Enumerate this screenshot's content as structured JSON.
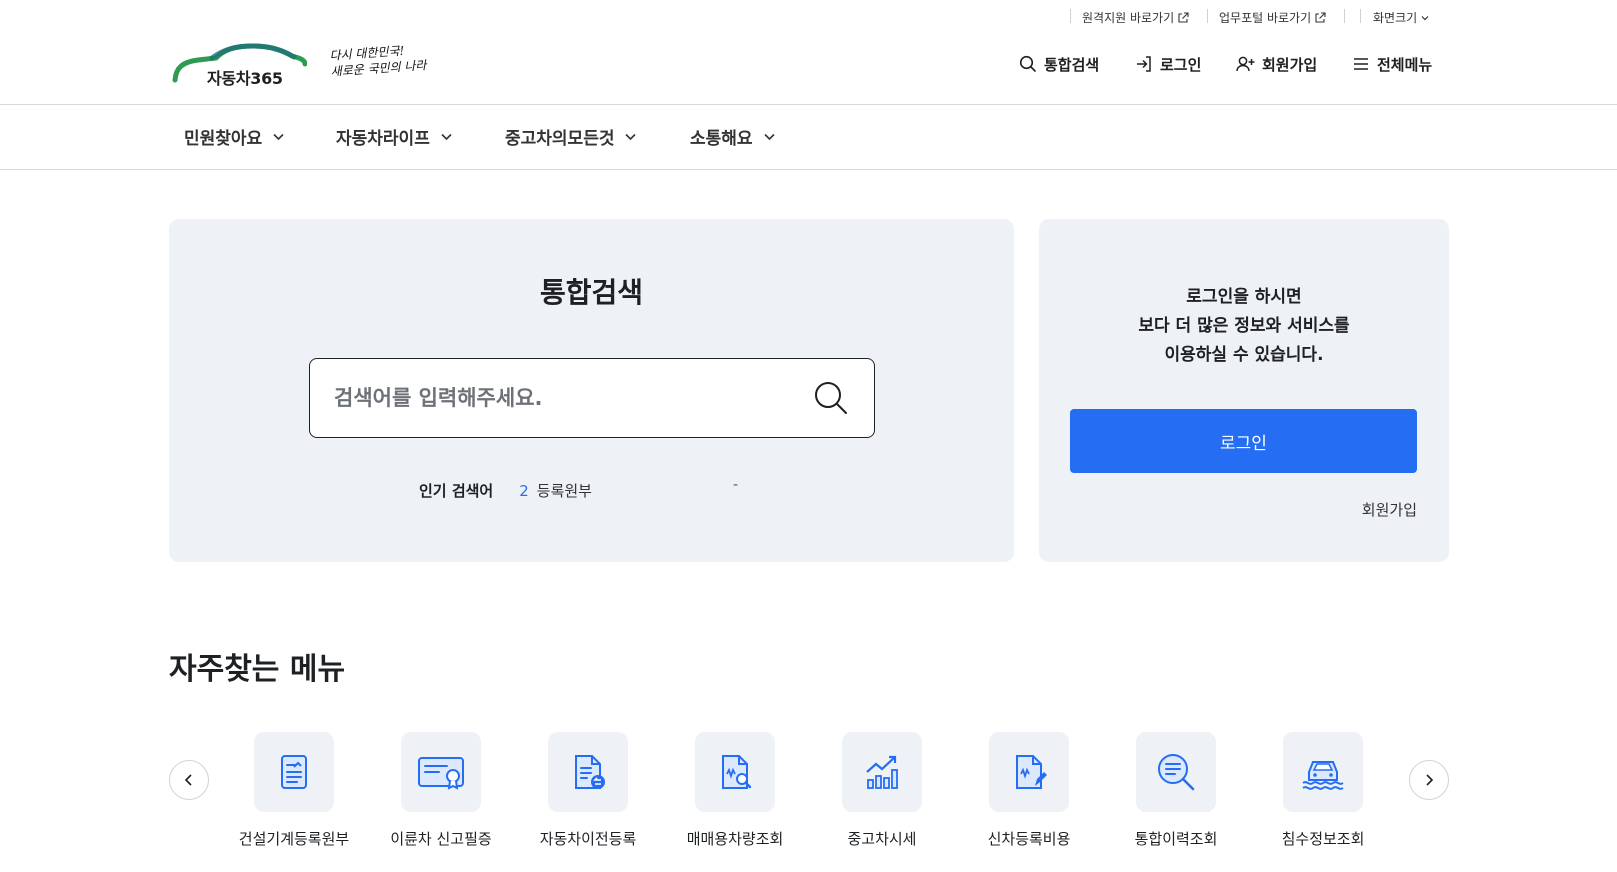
{
  "colors": {
    "accent": "#256ef4",
    "card_bg": "#eef1f5",
    "logo_green": "#2e9b53",
    "logo_teal": "#1f6f7a"
  },
  "utility": {
    "remote_support": "원격지원 바로가기",
    "business_portal": "업무포털 바로가기",
    "screen_size": "화면크기"
  },
  "logo": {
    "text": "자동차365"
  },
  "slogan": {
    "line1": "다시 대한민국!",
    "line2": "새로운 국민의 나라"
  },
  "header": {
    "search": "통합검색",
    "login": "로그인",
    "signup": "회원가입",
    "all_menu": "전체메뉴"
  },
  "nav": {
    "items": [
      {
        "label": "민원찾아요"
      },
      {
        "label": "자동차라이프"
      },
      {
        "label": "중고차의모든것"
      },
      {
        "label": "소통해요"
      }
    ]
  },
  "search": {
    "title": "통합검색",
    "placeholder": "검색어를 입력해주세요.",
    "popular_label": "인기 검색어",
    "popular_rank": "2",
    "popular_word": "등록원부",
    "popular_dash": "-"
  },
  "login_card": {
    "line1": "로그인을 하시면",
    "line2": "보다 더 많은 정보와 서비스를",
    "line3": "이용하실 수 있습니다.",
    "button": "로그인",
    "join": "회원가입"
  },
  "frequent": {
    "title": "자주찾는 메뉴",
    "items": [
      {
        "label": "건설기계등록원부",
        "icon": "document-icon"
      },
      {
        "label": "이륜차 신고필증",
        "icon": "certificate-icon"
      },
      {
        "label": "자동차이전등록",
        "icon": "transfer-document-icon"
      },
      {
        "label": "매매용차량조회",
        "icon": "document-search-icon"
      },
      {
        "label": "중고차시세",
        "icon": "chart-trend-icon"
      },
      {
        "label": "신차등록비용",
        "icon": "document-pen-icon"
      },
      {
        "label": "통합이력조회",
        "icon": "search-list-icon"
      },
      {
        "label": "침수정보조회",
        "icon": "flooded-car-icon"
      }
    ]
  }
}
